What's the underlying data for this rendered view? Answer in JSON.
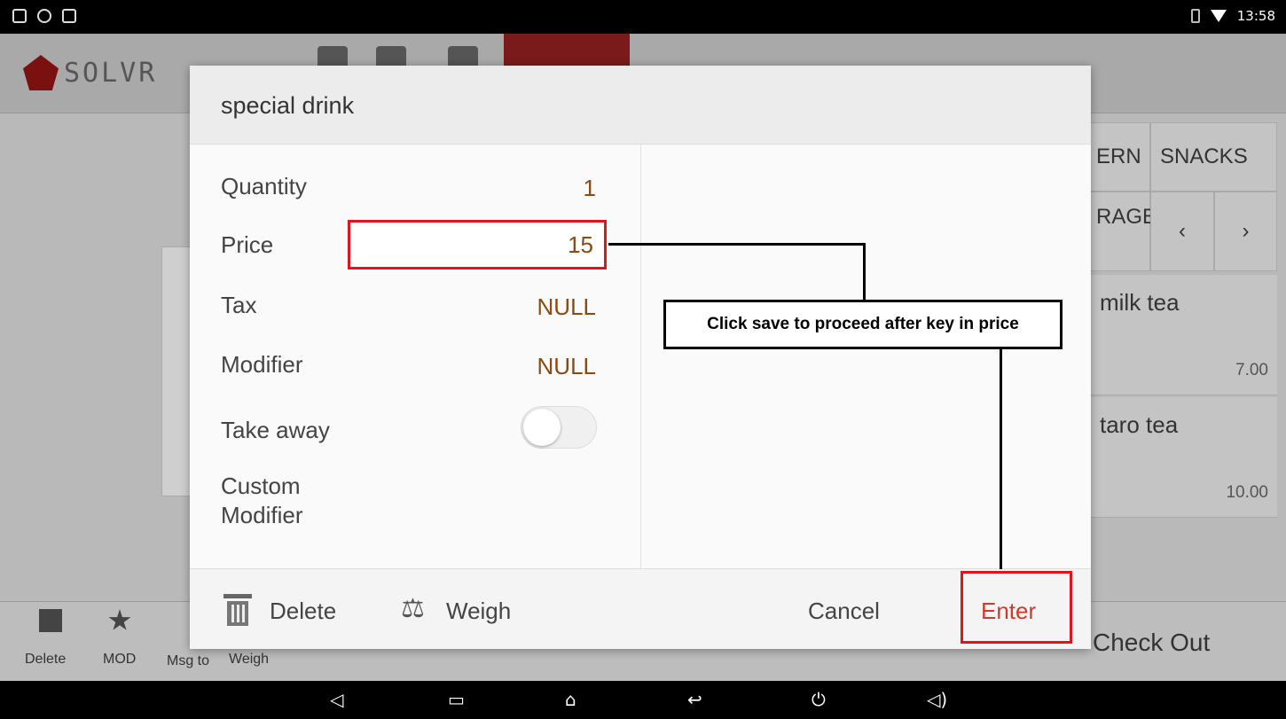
{
  "status_bar": {
    "time": "13:58"
  },
  "background": {
    "logo_text": "SOLVR",
    "categories": [
      "ERN",
      "SNACKS",
      "RAGE"
    ],
    "items": [
      {
        "name": "milk tea",
        "price": "7.00"
      },
      {
        "name": "taro tea",
        "price": "10.00"
      }
    ],
    "bottom_buttons": [
      "Delete",
      "MOD",
      "Msg to",
      "Weigh"
    ],
    "checkout_label": "Check Out"
  },
  "dialog": {
    "title": "special drink",
    "fields": {
      "quantity": {
        "label": "Quantity",
        "value": "1"
      },
      "price": {
        "label": "Price",
        "value": "15"
      },
      "tax": {
        "label": "Tax",
        "value": "NULL"
      },
      "modifier": {
        "label": "Modifier",
        "value": "NULL"
      },
      "take_away": {
        "label": "Take away",
        "on": false
      },
      "custom_modifier": {
        "label_line1": "Custom",
        "label_line2": "Modifier"
      }
    },
    "footer": {
      "delete_label": "Delete",
      "weigh_label": "Weigh",
      "cancel_label": "Cancel",
      "enter_label": "Enter"
    }
  },
  "annotation": {
    "text": "Click save to proceed after key in price"
  },
  "colors": {
    "highlight": "#e0141e",
    "value_text": "#8a4a14",
    "enter_text": "#d03a2a"
  }
}
